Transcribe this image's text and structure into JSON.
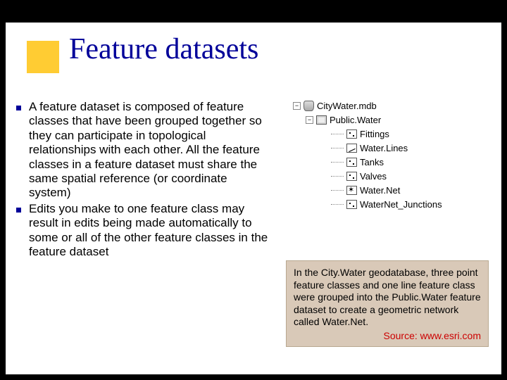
{
  "title": "Feature datasets",
  "bullets": [
    "A feature dataset is composed of feature classes that have been grouped together so they can participate in topological relationships with each other. All the feature classes in a feature dataset must share the same spatial reference (or coordinate system)",
    "Edits you make to one feature class may result in edits being made automatically to some or all of the other feature classes in the feature dataset"
  ],
  "tree": {
    "root": "CityWater.mdb",
    "dataset": "Public.Water",
    "children": [
      {
        "label": "Fittings",
        "icon": "point"
      },
      {
        "label": "Water.Lines",
        "icon": "line"
      },
      {
        "label": "Tanks",
        "icon": "point"
      },
      {
        "label": "Valves",
        "icon": "point"
      },
      {
        "label": "Water.Net",
        "icon": "net"
      },
      {
        "label": "WaterNet_Junctions",
        "icon": "point"
      }
    ]
  },
  "caption": {
    "text": "In the City.Water geodatabase, three point feature classes and one line feature class were grouped into the Public.Water feature dataset to create a geometric network called Water.Net.",
    "source": "Source: www.esri.com"
  }
}
